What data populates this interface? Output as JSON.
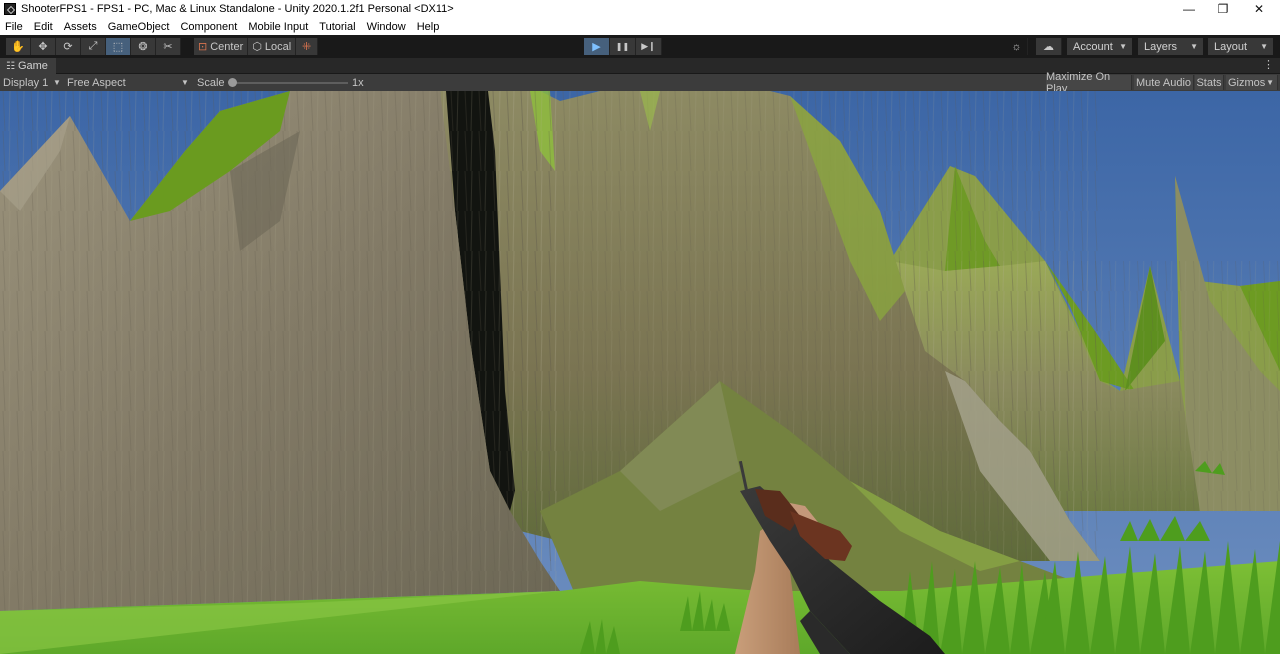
{
  "window": {
    "title": "ShooterFPS1 - FPS1 - PC, Mac & Linux Standalone - Unity 2020.1.2f1 Personal <DX11>",
    "controls": {
      "minimize": "—",
      "restore": "❐",
      "close": "✕"
    }
  },
  "menu": [
    "File",
    "Edit",
    "Assets",
    "GameObject",
    "Component",
    "Mobile Input",
    "Tutorial",
    "Window",
    "Help"
  ],
  "toolbar": {
    "tools": [
      {
        "name": "hand-tool-icon",
        "glyph": "✋"
      },
      {
        "name": "move-tool-icon",
        "glyph": "✥"
      },
      {
        "name": "rotate-tool-icon",
        "glyph": "⟳"
      },
      {
        "name": "scale-tool-icon",
        "glyph": "⤢"
      },
      {
        "name": "rect-tool-icon",
        "glyph": "⬚"
      },
      {
        "name": "transform-tool-icon",
        "glyph": "❂"
      },
      {
        "name": "custom-tool-icon",
        "glyph": "✂"
      }
    ],
    "pivot_label": "Center",
    "space_label": "Local",
    "play": "▶",
    "pause": "❚❚",
    "step": "▶❙",
    "account_label": "Account",
    "layers_label": "Layers",
    "layout_label": "Layout",
    "collab_icon": "☼",
    "cloud_icon": "☁"
  },
  "game_tab": {
    "label": "Game",
    "icon": "game-controller-icon",
    "menu_glyph": "⋮"
  },
  "game_bar": {
    "display": "Display 1",
    "aspect": "Free Aspect",
    "scale_label": "Scale",
    "scale_value": "1x",
    "scale_fraction": 0,
    "maximize_on_play": "Maximize On Play",
    "mute_audio": "Mute Audio",
    "stats": "Stats",
    "gizmos": "Gizmos"
  },
  "colors": {
    "sky": "#3d6aa7",
    "rock": "#8a8370",
    "moss": "#6e8a2a",
    "grass": "#69b52e",
    "accent": "#46607c"
  }
}
